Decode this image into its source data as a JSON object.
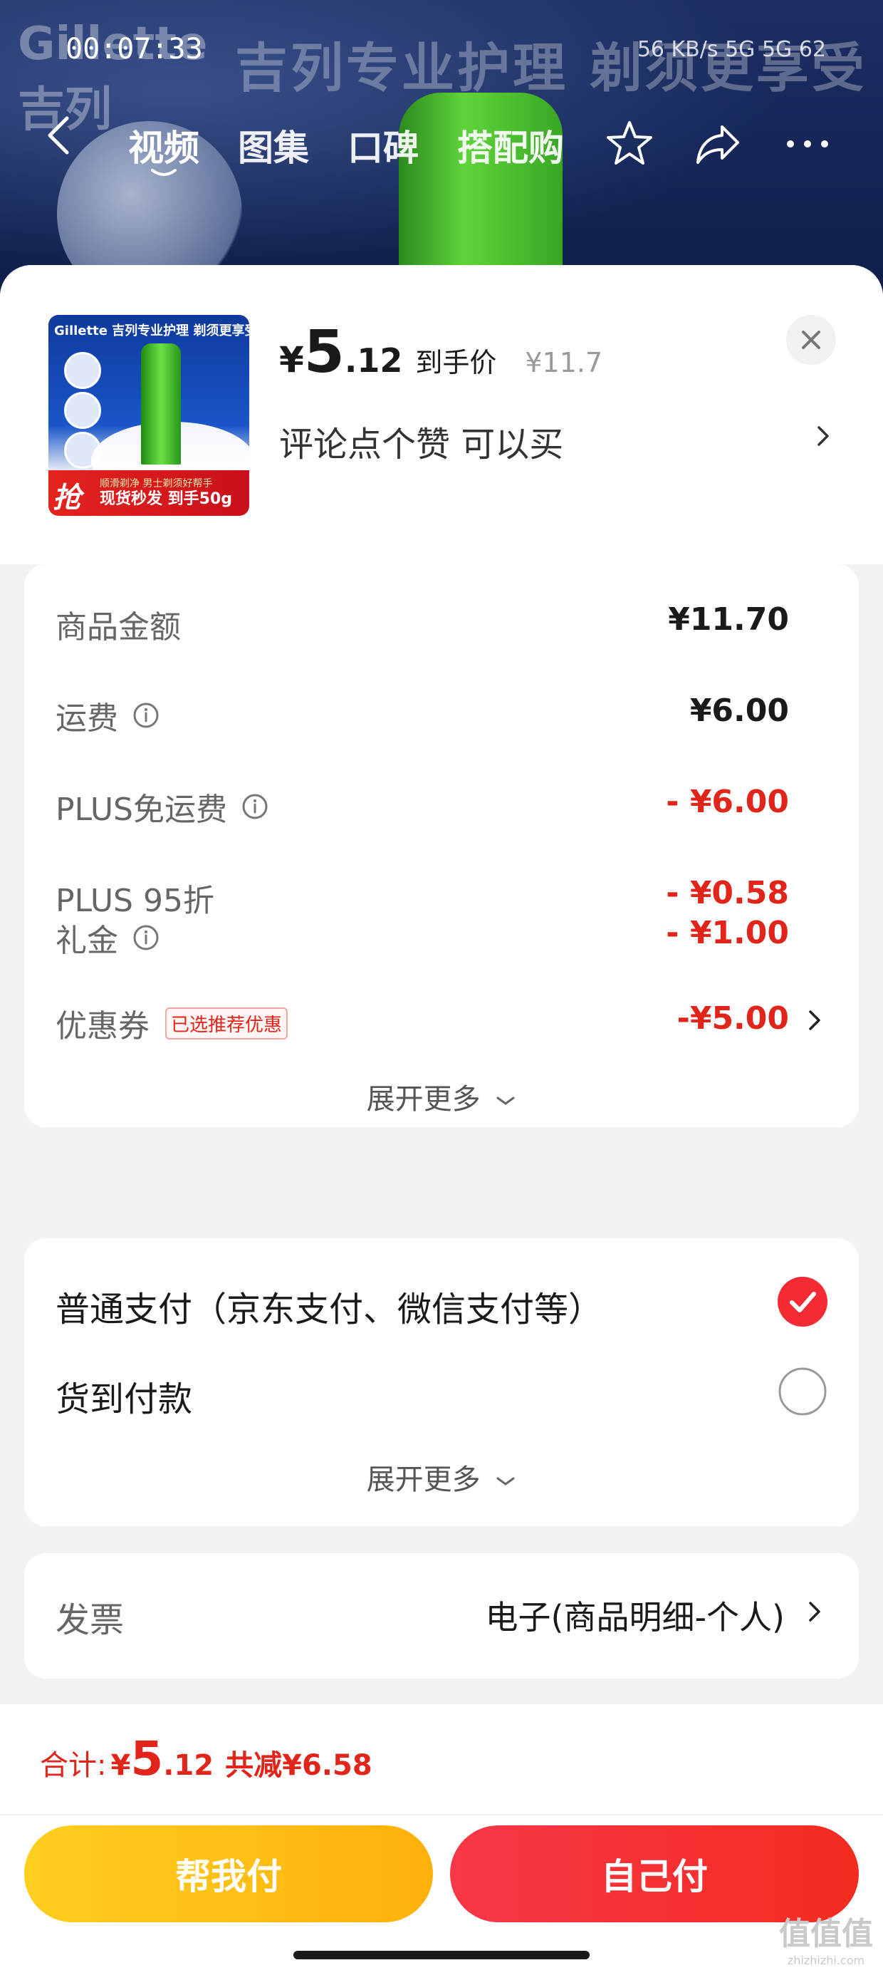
{
  "status_bar": {
    "time": "00:07:33",
    "right_text": "56 KB/s  5G  5G  62"
  },
  "banner": {
    "brand_en": "Gillette",
    "brand_cn": "吉列",
    "slogan": "吉列专业护理 剃须更享受",
    "tabs": [
      "视频",
      "图集",
      "口碑",
      "搭配购"
    ]
  },
  "product": {
    "thumb_title": "Gillette 吉列专业护理 剃须更享受",
    "thumb_badge": "抢",
    "thumb_small": "顺滑剃净 男士剃须好帮手",
    "thumb_bottom": "现货秒发 到手50g",
    "yen": "¥",
    "price_int": "5",
    "price_dec": ".12",
    "price_tag": "到手价",
    "price_orig": "¥11.7",
    "subtitle": "评论点个赞  可以买"
  },
  "summary": {
    "rows": [
      {
        "label": "商品金额",
        "value": "¥11.70",
        "info": false,
        "red": false
      },
      {
        "label": "运费",
        "value": "¥6.00",
        "info": true,
        "red": false
      },
      {
        "label": "PLUS免运费",
        "value": "- ¥6.00",
        "info": true,
        "red": true
      },
      {
        "label": "PLUS 95折",
        "value": "- ¥0.58",
        "info": false,
        "red": true
      },
      {
        "label": "礼金",
        "value": "- ¥1.00",
        "info": true,
        "red": true
      },
      {
        "label": "优惠券",
        "value": "-¥5.00",
        "tag": "已选推荐优惠",
        "red": true
      }
    ],
    "expand_label": "展开更多"
  },
  "payment": {
    "options": [
      {
        "label": "普通支付（京东支付、微信支付等）",
        "selected": true
      },
      {
        "label": "货到付款",
        "selected": false
      }
    ],
    "expand_label": "展开更多"
  },
  "invoice": {
    "label": "发票",
    "value": "电子(商品明细-个人)"
  },
  "footer": {
    "total_label": "合计:",
    "total_yen": "¥",
    "total_int": "5",
    "total_dec": ".12",
    "saving": "共减¥6.58",
    "help_pay": "帮我付",
    "self_pay": "自己付"
  },
  "watermark": {
    "main": "值值值",
    "sub": "zhizhizhi.com"
  },
  "colors": {
    "accent_red": "#e1251b",
    "help_yellow": "#ffbf14",
    "self_red": "#f5302a"
  }
}
